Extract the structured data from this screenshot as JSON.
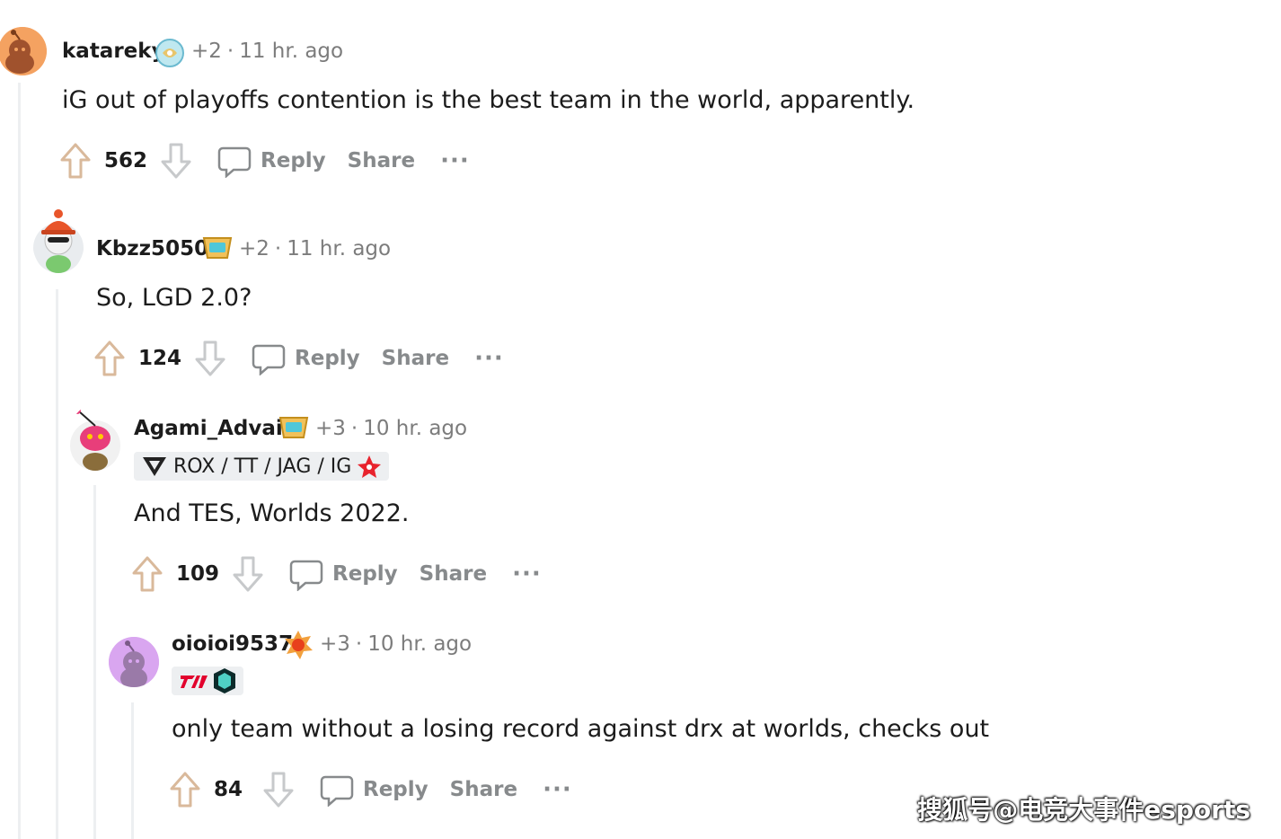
{
  "comments": [
    {
      "author": "katareky",
      "karma": "+2",
      "time": "11 hr. ago",
      "text": "iG out of playoffs contention is the best team in the world, apparently.",
      "score": "562",
      "avatar_color": "#f4a261"
    },
    {
      "author": "Kbzz5050",
      "karma": "+2",
      "time": "11 hr. ago",
      "text": "So, LGD 2.0?",
      "score": "124",
      "avatar_color": "#e9ecef"
    },
    {
      "author": "Agami_Advait",
      "karma": "+3",
      "time": "10 hr. ago",
      "flair": "ROX / TT / JAG / IG",
      "text": "And TES, Worlds 2022.",
      "score": "109",
      "avatar_color": "#e83e7a"
    },
    {
      "author": "oioioi9537",
      "karma": "+3",
      "time": "10 hr. ago",
      "text": "only team without a losing record against drx at worlds, checks out",
      "score": "84",
      "avatar_color": "#d9a6f0"
    }
  ],
  "actions": {
    "reply": "Reply",
    "share": "Share",
    "more": "···"
  },
  "meta_separator": "·",
  "watermark": "搜狐号@电竞大事件esports",
  "colors": {
    "upvote": "#d9b99b",
    "downvote": "#878a8c",
    "muted": "#878a8c"
  }
}
